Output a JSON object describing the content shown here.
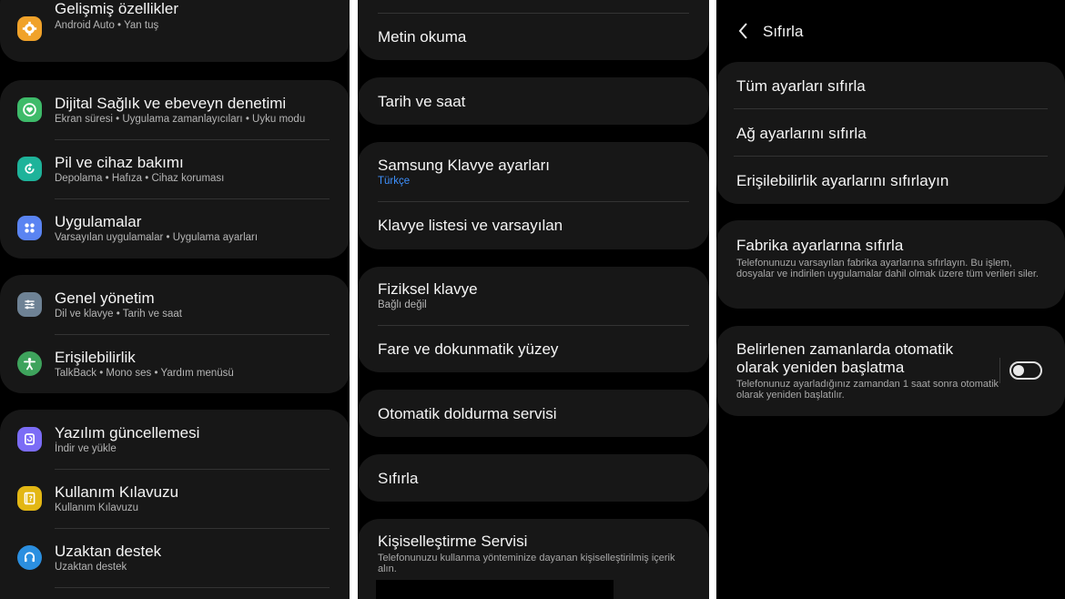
{
  "left_panel": {
    "items": [
      {
        "title": "Gelişmiş özellikler",
        "subtitle": "Android Auto  •  Yan tuş",
        "icon": "gear-star-icon",
        "color": "#f0a22a"
      },
      {
        "title": "Dijital Sağlık ve ebeveyn denetimi",
        "subtitle": "Ekran süresi  •  Uygulama zamanlayıcıları  •  Uyku modu",
        "icon": "heart-circle-icon",
        "color": "#3ebb6a"
      },
      {
        "title": "Pil ve cihaz bakımı",
        "subtitle": "Depolama  •  Hafıza  •  Cihaz koruması",
        "icon": "refresh-circle-icon",
        "color": "#1eb39a"
      },
      {
        "title": "Uygulamalar",
        "subtitle": "Varsayılan uygulamalar  •  Uygulama ayarları",
        "icon": "apps-grid-icon",
        "color": "#5a84f2"
      },
      {
        "title": "Genel yönetim",
        "subtitle": "Dil ve klavye  •  Tarih ve saat",
        "icon": "sliders-icon",
        "color": "#6e8295"
      },
      {
        "title": "Erişilebilirlik",
        "subtitle": "TalkBack  •  Mono ses  •  Yardım menüsü",
        "icon": "accessibility-person-icon",
        "color": "#3ea35c"
      },
      {
        "title": "Yazılım güncellemesi",
        "subtitle": "İndir ve yükle",
        "icon": "update-icon",
        "color": "#7b6cf6"
      },
      {
        "title": "Kullanım Kılavuzu",
        "subtitle": "Kullanım Kılavuzu",
        "icon": "help-book-icon",
        "color": "#e3b714"
      },
      {
        "title": "Uzaktan destek",
        "subtitle": "Uzaktan destek",
        "icon": "headset-icon",
        "color": "#2b8fe0"
      }
    ]
  },
  "middle_panel": {
    "items": [
      {
        "title": "Metin okuma"
      },
      {
        "title": "Tarih ve saat"
      },
      {
        "title": "Samsung Klavye ayarları",
        "subtitle": "Türkçe"
      },
      {
        "title": "Klavye listesi ve varsayılan"
      },
      {
        "title": "Fiziksel klavye",
        "subtitle": "Bağlı değil"
      },
      {
        "title": "Fare ve dokunmatik yüzey"
      },
      {
        "title": "Otomatik doldurma servisi"
      },
      {
        "title": "Sıfırla"
      },
      {
        "title": "Kişiselleştirme Servisi",
        "description": "Telefonunuzu kullanma yönteminize dayanan kişiselleştirilmiş içerik alın."
      }
    ]
  },
  "right_panel": {
    "header": {
      "title": "Sıfırla",
      "back_icon": "chevron-left-icon"
    },
    "items": [
      {
        "title": "Tüm ayarları sıfırla"
      },
      {
        "title": "Ağ ayarlarını sıfırla"
      },
      {
        "title": "Erişilebilirlik ayarlarını sıfırlayın"
      }
    ],
    "factory_reset": {
      "title": "Fabrika ayarlarına sıfırla",
      "description": "Telefonunuzu varsayılan fabrika ayarlarına sıfırlayın. Bu işlem, dosyalar ve indirilen uygulamalar dahil olmak üzere tüm verileri siler."
    },
    "auto_restart": {
      "title_line1": "Belirlenen zamanlarda otomatik",
      "title_line2": "olarak yeniden başlatma",
      "description": "Telefonunuz ayarladığınız zamandan 1 saat sonra otomatik olarak yeniden başlatılır.",
      "toggle_on": false
    }
  }
}
